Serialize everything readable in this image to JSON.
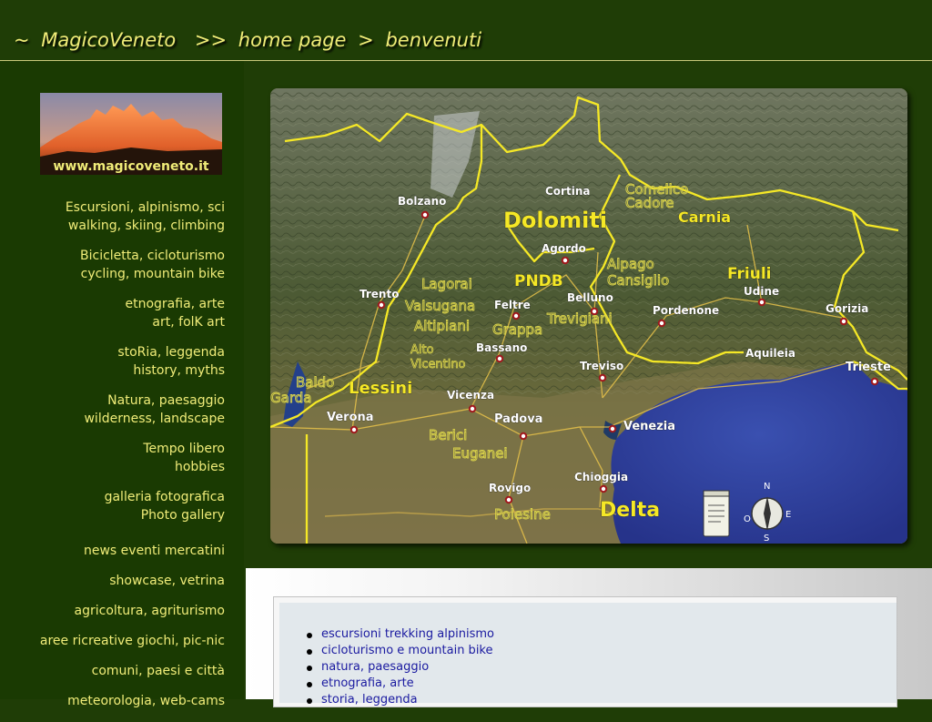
{
  "header": {
    "tilde": "~",
    "site_name": "MagicoVeneto",
    "sep1": ">>",
    "crumb_home": "home page",
    "sep2": ">",
    "crumb_current": "benvenuti"
  },
  "logo": {
    "caption": "www.magicoveneto.it"
  },
  "nav": [
    {
      "line1": "Escursioni, alpinismo, sci",
      "line2": "walking, skiing, climbing"
    },
    {
      "line1": "Bicicletta, cicloturismo",
      "line2": "cycling, mountain bike"
    },
    {
      "line1": "etnografia, arte",
      "line2": "art, folK art"
    },
    {
      "line1": "stoRia, leggenda",
      "line2": "history, myths"
    },
    {
      "line1": "Natura, paesaggio",
      "line2": "wilderness, landscape"
    },
    {
      "line1": "Tempo libero",
      "line2": "hobbies"
    },
    {
      "line1": "galleria fotografica",
      "line2": "Photo gallery"
    },
    {
      "line1": "news eventi mercatini"
    },
    {
      "line1": "showcase, vetrina"
    },
    {
      "line1": "agricoltura, agriturismo"
    },
    {
      "line1": "aree ricreative giochi, pic-nic"
    },
    {
      "line1": "comuni, paesi e città"
    },
    {
      "line1": "meteorologia, web-cams"
    }
  ],
  "map": {
    "cities": {
      "bolzano": "Bolzano",
      "cortina": "Cortina",
      "agordo": "Agordo",
      "trento": "Trento",
      "feltre": "Feltre",
      "belluno": "Belluno",
      "pordenone": "Pordenone",
      "udine": "Udine",
      "gorizia": "Gorizia",
      "bassano": "Bassano",
      "treviso": "Treviso",
      "aquileia": "Aquileia",
      "trieste": "Trieste",
      "vicenza": "Vicenza",
      "padova": "Padova",
      "verona": "Verona",
      "venezia": "Venezia",
      "chioggia": "Chioggia",
      "rovigo": "Rovigo"
    },
    "regions": {
      "dolomiti": "Dolomiti",
      "carnia": "Carnia",
      "comelico": "Comelico",
      "cadore": "Cadore",
      "pndb": "PNDB",
      "alpago": "Alpago",
      "cansiglio": "Cansiglio",
      "friuli": "Friuli",
      "lagorai": "Lagorai",
      "valsugana": "Valsugana",
      "altipiani": "Altipiani",
      "grappa": "Grappa",
      "trevigiani": "Trevigiani",
      "alto": "Alto",
      "vicentino": "Vicentino",
      "baldo": "Baldo",
      "garda": "Garda",
      "lessini": "Lessini",
      "berici": "Berici",
      "euganei": "Euganei",
      "polesine": "Polesine",
      "delta": "Delta"
    },
    "compass": {
      "n": "N",
      "s": "S",
      "e": "E",
      "o": "O"
    }
  },
  "content": {
    "links": [
      "escursioni trekking alpinismo",
      "cicloturismo e mountain bike",
      "natura, paesaggio",
      "etnografia, arte",
      "storia, leggenda"
    ]
  }
}
